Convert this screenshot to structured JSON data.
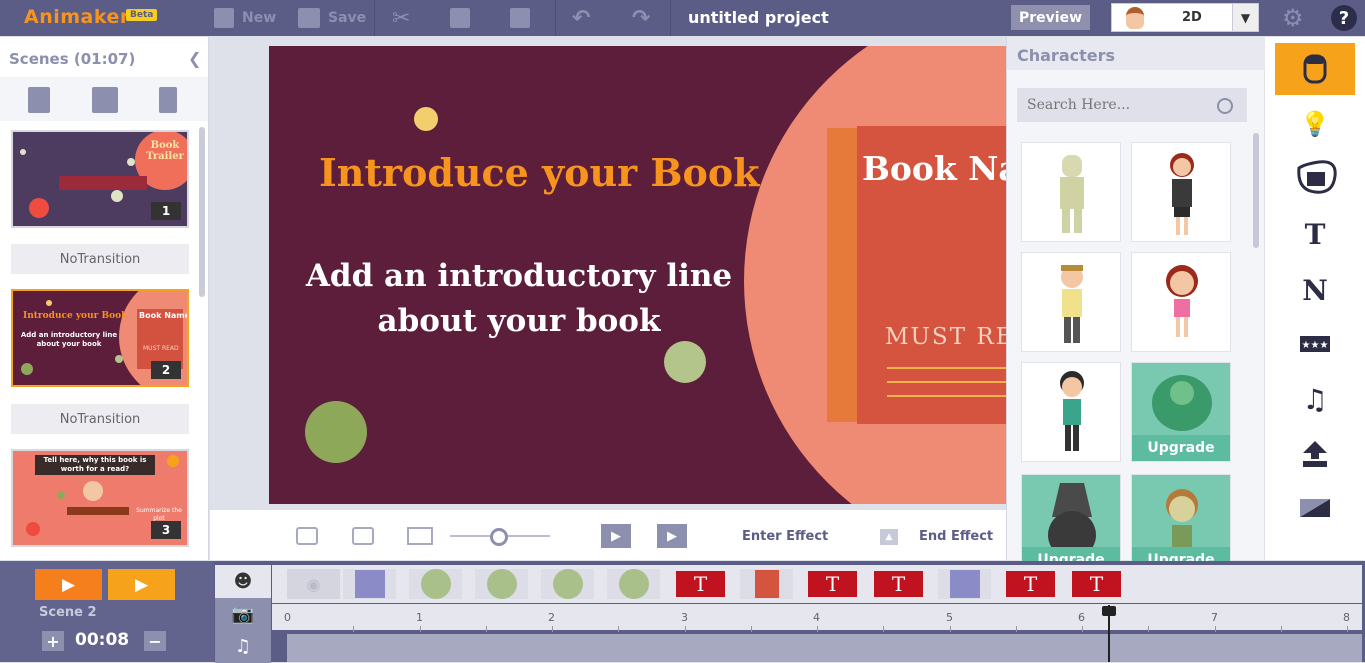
{
  "app": {
    "logo": "Animaker",
    "beta": "Beta",
    "project_title": "untitled project"
  },
  "toolbar": {
    "new": "New",
    "save": "Save",
    "preview": "Preview",
    "mode": "2D",
    "help": "?"
  },
  "scenes": {
    "title": "Scenes (01:07)",
    "items": [
      {
        "num": "1",
        "preview_text": "Book Trailer"
      },
      {
        "num": "2",
        "preview_title": "Introduce your Book",
        "preview_sub": "Add an introductory line about your book",
        "preview_book": "Book Name",
        "preview_must": "MUST READ"
      },
      {
        "num": "3",
        "preview_title": "Tell here, why this book is worth for a read?",
        "preview_sub": "Summarize the plot"
      }
    ],
    "transition": "NoTransition"
  },
  "canvas": {
    "title": "Introduce your Book",
    "subtitle": "Add an introductory line about your book",
    "book_name": "Book Na",
    "must_read": "MUST REA"
  },
  "canvas_toolbar": {
    "enter_effect": "Enter Effect",
    "end_effect": "End Effect",
    "zoom_fraction": 0.5
  },
  "characters": {
    "title": "Characters",
    "search_placeholder": "Search Here...",
    "upgrade": "Upgrade"
  },
  "timeline": {
    "scene": "Scene 2",
    "duration": "00:08",
    "plus": "+",
    "minus": "−",
    "ticks": [
      "0",
      "1",
      "2",
      "3",
      "4",
      "5",
      "6",
      "7",
      "8"
    ],
    "text_block": "T"
  },
  "colors": {
    "accent": "#f7a21b",
    "toolbar_bg": "#5b5d87",
    "canvas_bg": "#5d1e3c",
    "title_orange": "#f7941d",
    "text_block_red": "#c1121f"
  }
}
